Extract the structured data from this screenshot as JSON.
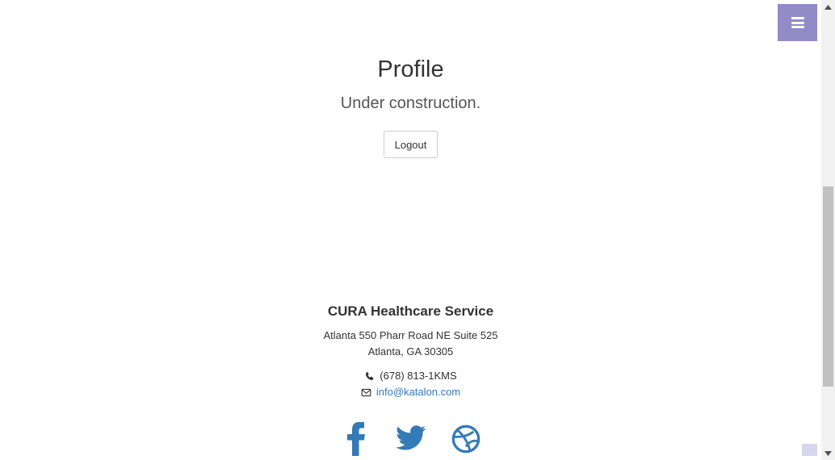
{
  "nav": {
    "menu_icon": "hamburger-icon",
    "accent_color": "#928bc7"
  },
  "profile": {
    "title": "Profile",
    "subtitle": "Under construction.",
    "logout_label": "Logout"
  },
  "footer": {
    "company": "CURA Healthcare Service",
    "address_line1": "Atlanta 550 Pharr Road NE Suite 525",
    "address_line2": "Atlanta, GA 30305",
    "phone": "(678) 813-1KMS",
    "email": "info@katalon.com",
    "link_color": "#337ab7",
    "social": [
      "facebook-icon",
      "twitter-icon",
      "dribbble-icon"
    ]
  }
}
